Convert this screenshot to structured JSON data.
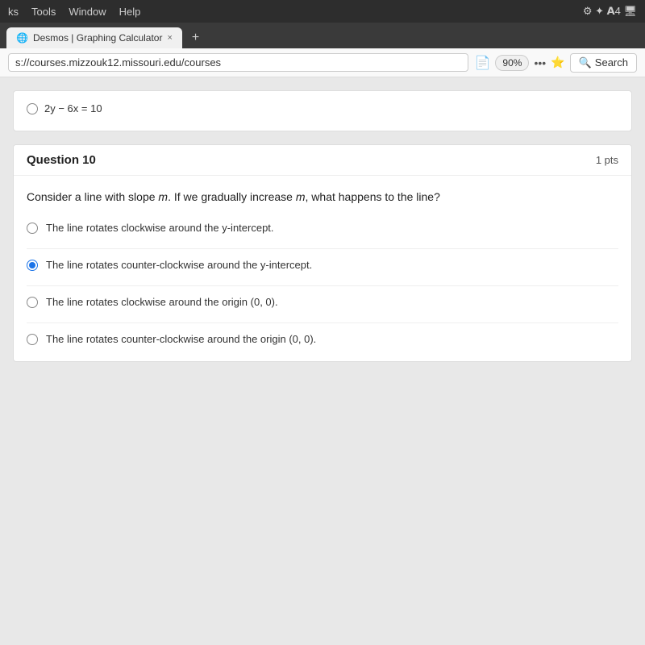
{
  "titlebar": {
    "menus": [
      "ks",
      "Tools",
      "Window",
      "Help"
    ]
  },
  "tabbar": {
    "active_tab": "Desmos | Graphing Calculator",
    "tab_x": "×",
    "new_tab": "+"
  },
  "addressbar": {
    "url": "s://courses.mizzouk12.missouri.edu/courses",
    "zoom": "90%",
    "search_label": "Search"
  },
  "prev_fragment": {
    "equation": "2y − 6x = 10"
  },
  "question": {
    "title": "Question 10",
    "points": "1 pts",
    "text": "Consider a line with slope m. If we gradually increase m, what happens to the line?",
    "options": [
      {
        "id": "opt1",
        "label": "The line rotates clockwise around the y-intercept.",
        "selected": false
      },
      {
        "id": "opt2",
        "label": "The line rotates counter-clockwise around the y-intercept.",
        "selected": true
      },
      {
        "id": "opt3",
        "label": "The line rotates clockwise around the origin (0, 0).",
        "selected": false
      },
      {
        "id": "opt4",
        "label": "The line rotates counter-clockwise around the origin (0, 0).",
        "selected": false
      }
    ]
  }
}
